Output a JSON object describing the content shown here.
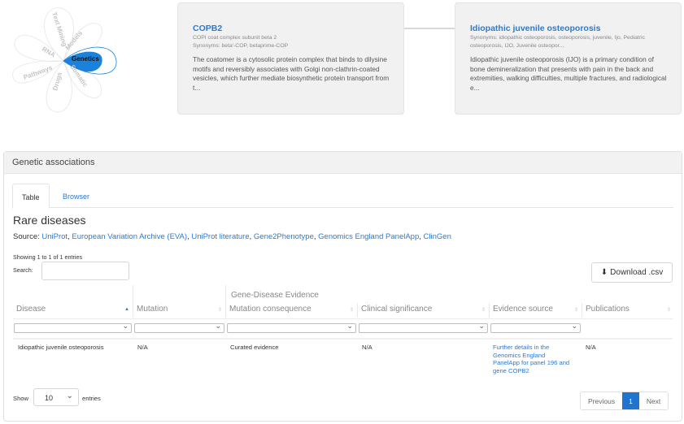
{
  "flower": {
    "petals": [
      "Text Mining",
      "Models",
      "Genetics",
      "Somatic",
      "Drugs",
      "Pathways",
      "RNA"
    ],
    "active": "Genetics",
    "active_color": "#1a82db"
  },
  "gene_card": {
    "title": "COPB2",
    "full_name": "COPI coat complex subunit beta 2",
    "synonyms": "Synonyms: beta'-COP, betaprime-COP",
    "description": "The coatomer is a cytosolic protein complex that binds to dilysine motifs and reversibly associates with Golgi non-clathrin-coated vesicles, which further mediate biosynthetic protein transport from t..."
  },
  "disease_card": {
    "title": "Idiopathic juvenile osteoporosis",
    "synonyms": "Synonyms: idiopathic osteoporosis, osteoporosis, juvenile, Ijo, Pediatric osteoporosis, IJO, Juvenile osteopor...",
    "description": "Idiopathic juvenile osteoporosis (IJO) is a primary condition of bone demineralization that presents with pain in the back and extremities, walking difficulties, multiple fractures, and radiological e..."
  },
  "panel": {
    "title": "Genetic associations",
    "tabs": [
      {
        "label": "Table",
        "active": true
      },
      {
        "label": "Browser",
        "active": false
      }
    ],
    "section_title": "Rare diseases",
    "source_label": "Source:",
    "sources": [
      "UniProt",
      "European Variation Archive (EVA)",
      "UniProt literature",
      "Gene2Phenotype",
      "Genomics England PanelApp",
      "ClinGen"
    ],
    "showing": "Showing 1 to 1 of 1 entries",
    "search_label": "Search:",
    "search_value": "",
    "download_label": "Download .csv",
    "group_header": "Gene-Disease Evidence",
    "columns": [
      "Disease",
      "Mutation",
      "Mutation consequence",
      "Clinical significance",
      "Evidence source",
      "Publications"
    ],
    "sorted_column": "Disease",
    "rows": [
      {
        "disease": "Idiopathic juvenile osteoporosis",
        "mutation": "N/A",
        "mutation_consequence": "Curated evidence",
        "clinical_significance": "N/A",
        "evidence_source": "Further details in the Genomics England PanelApp for panel 196 and gene COPB2",
        "publications": "N/A"
      }
    ],
    "show_label": "Show",
    "page_size": "10",
    "entries_label": "entries",
    "pagination": {
      "previous": "Previous",
      "current": "1",
      "next": "Next"
    }
  },
  "icons": {
    "download": "⬇",
    "chevron": "⌄",
    "sort_up": "▲",
    "sort_both": "⇕"
  }
}
